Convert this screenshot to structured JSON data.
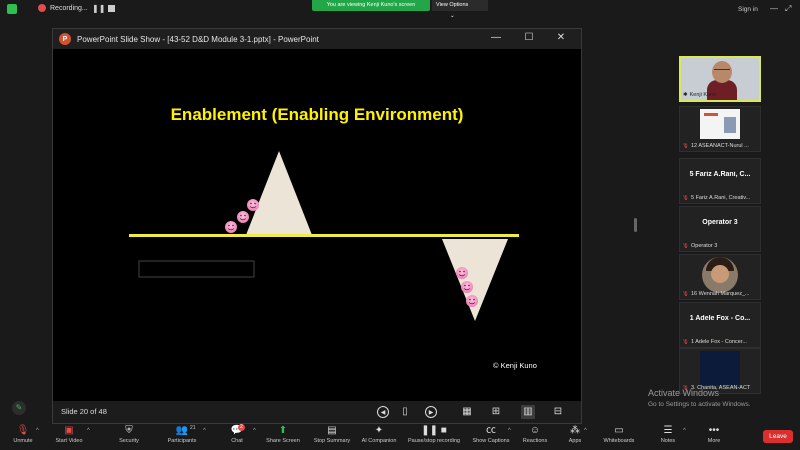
{
  "topbar": {
    "recording_label": "Recording...",
    "viewing_banner": "You are viewing Kenji Kuno's screen",
    "view_options_label": "View Options",
    "sign_in_label": "Sign in"
  },
  "ppt_window": {
    "title": "PowerPoint Slide Show - [43-52 D&D Module 3-1.pptx] - PowerPoint",
    "icon_letter": "P",
    "slide": {
      "title": "Enablement (Enabling Environment)",
      "copyright": "© Kenji Kuno"
    },
    "status": {
      "slide_counter": "Slide 20 of 48"
    }
  },
  "participants": [
    {
      "name": "Kenji Kuno",
      "kind": "video-host"
    },
    {
      "name": "12 ASEANACT-Nurul ...",
      "kind": "shared"
    },
    {
      "name": "5 Fariz A.Rani, Creativ...",
      "big": "5 Fariz A.Rani, C...",
      "kind": "text"
    },
    {
      "name": "Operator 3",
      "big": "Operator 3",
      "kind": "text"
    },
    {
      "name": "16 Wennah Marquez_...",
      "kind": "video"
    },
    {
      "name": "1 Adele Fox - Concer...",
      "big": "1 Adele Fox - Co...",
      "kind": "text"
    },
    {
      "name": "3. Chanita, ASEAN-ACT",
      "kind": "dark"
    }
  ],
  "windows_watermark": {
    "title": "Activate Windows",
    "subtitle": "Go to Settings to activate Windows."
  },
  "toolbar": {
    "unmute": "Unmute",
    "start_video": "Start Video",
    "security": "Security",
    "participants": "Participants",
    "participants_count": "21",
    "chat": "Chat",
    "chat_badge": "2",
    "share_screen": "Share Screen",
    "stop_summary": "Stop Summary",
    "ai_companion": "AI Companion",
    "pause_stop_recording": "Pause/stop recording",
    "show_captions": "Show Captions",
    "reactions": "Reactions",
    "apps": "Apps",
    "whiteboards": "Whiteboards",
    "notes": "Notes",
    "more": "More",
    "leave": "Leave"
  }
}
